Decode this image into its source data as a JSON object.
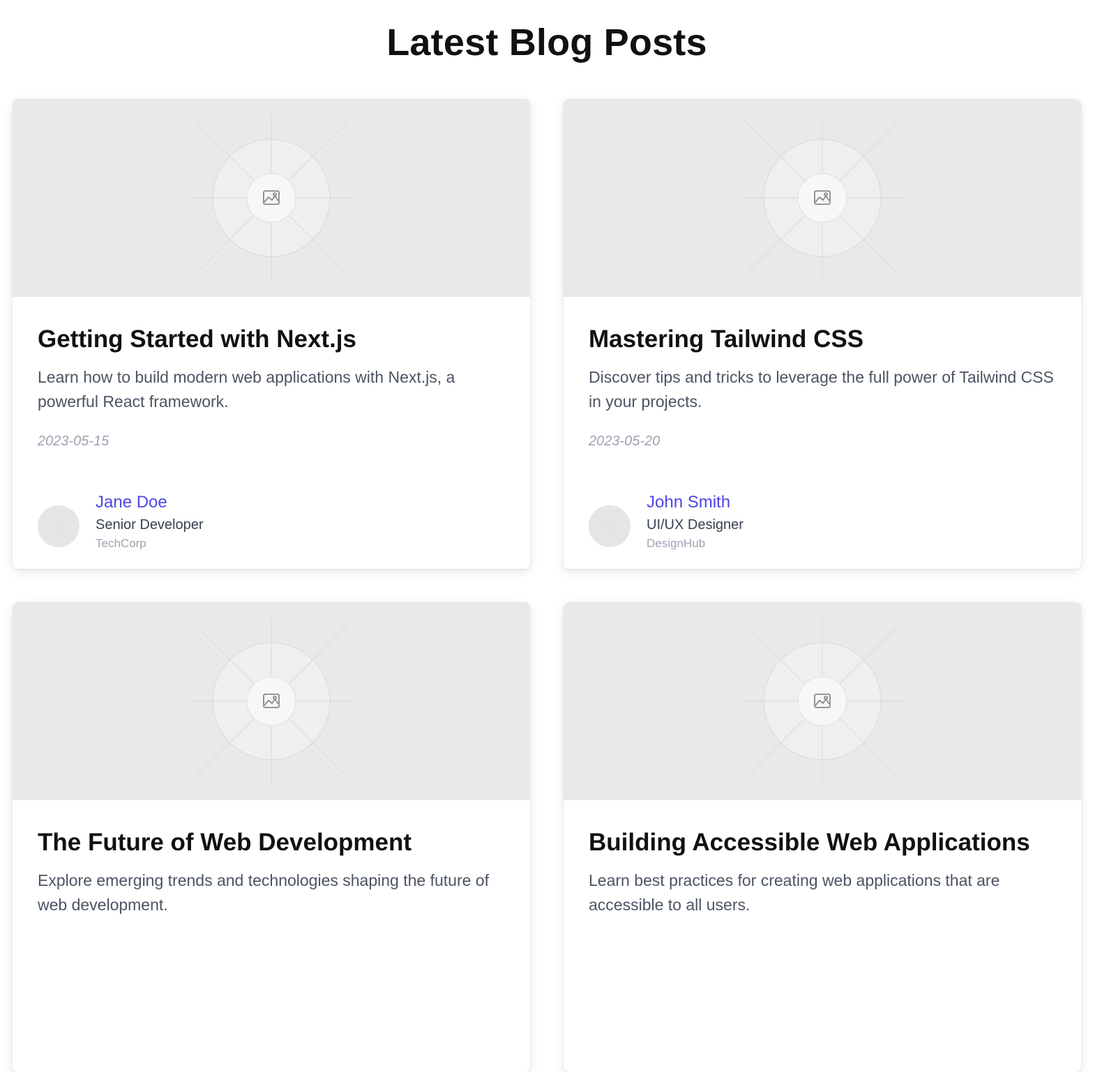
{
  "page": {
    "title": "Latest Blog Posts"
  },
  "posts": [
    {
      "title": "Getting Started with Next.js",
      "excerpt": "Learn how to build modern web applications with Next.js, a powerful React framework.",
      "date": "2023-05-15",
      "author": {
        "name": "Jane Doe",
        "role": "Senior Developer",
        "company": "TechCorp"
      },
      "image_icon": "image-placeholder-icon"
    },
    {
      "title": "Mastering Tailwind CSS",
      "excerpt": "Discover tips and tricks to leverage the full power of Tailwind CSS in your projects.",
      "date": "2023-05-20",
      "author": {
        "name": "John Smith",
        "role": "UI/UX Designer",
        "company": "DesignHub"
      },
      "image_icon": "image-placeholder-icon"
    },
    {
      "title": "The Future of Web Development",
      "excerpt": "Explore emerging trends and technologies shaping the future of web development.",
      "date": "",
      "author": {
        "name": "",
        "role": "",
        "company": ""
      },
      "image_icon": "image-placeholder-icon"
    },
    {
      "title": "Building Accessible Web Applications",
      "excerpt": "Learn best practices for creating web applications that are accessible to all users.",
      "date": "",
      "author": {
        "name": "",
        "role": "",
        "company": ""
      },
      "image_icon": "image-placeholder-icon"
    }
  ],
  "colors": {
    "accent": "#4f46e5",
    "image_bg": "#e9e9e9",
    "muted_text": "#9ca3af",
    "body_text": "#4b5563"
  }
}
